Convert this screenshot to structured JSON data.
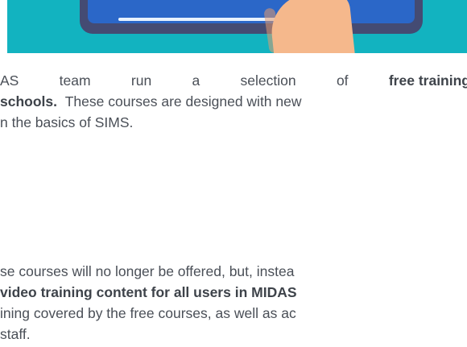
{
  "hero": {
    "colors": {
      "background": "#12b3c0",
      "laptop_frame": "#444b73",
      "laptop_screen": "#2b67c8",
      "hand": "#f5b88c"
    },
    "icon": "laptop-hand-illustration"
  },
  "paragraph1": {
    "line1": [
      "AS",
      "team",
      "run",
      "a",
      "selection",
      "of",
      "free training cou"
    ],
    "line2_bold": "schools.",
    "line2_rest": "These courses are designed with new",
    "line3": "n the basics of SIMS."
  },
  "paragraph2": {
    "line1": "se courses will no longer be offered, but, instea",
    "line2_bold": "video training content for all users in MIDAS",
    "line3": "ining covered by the free courses, as well as ac",
    "line4": "staff."
  }
}
